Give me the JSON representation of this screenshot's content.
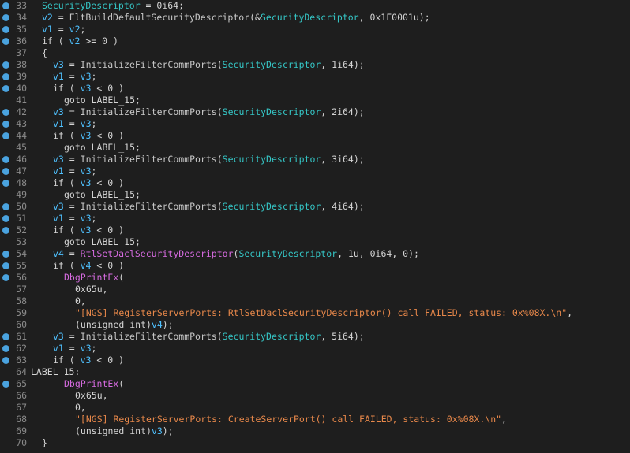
{
  "colors": {
    "background": "#1e1e1e",
    "breakpoint": "#4aa3df",
    "line_number": "#8a8a8a",
    "variable": "#4fc1ff",
    "security_descriptor": "#35c6c6",
    "api_call": "#d66be0",
    "string": "#e8884a",
    "default": "#d4d4d4"
  },
  "lines": [
    {
      "n": "33",
      "bp": true,
      "indent": 1,
      "tokens": [
        [
          "sd",
          "SecurityDescriptor"
        ],
        [
          "plain",
          " = 0i64;"
        ]
      ]
    },
    {
      "n": "34",
      "bp": true,
      "indent": 1,
      "tokens": [
        [
          "var",
          "v2"
        ],
        [
          "plain",
          " = "
        ],
        [
          "func",
          "FltBuildDefaultSecurityDescriptor"
        ],
        [
          "plain",
          "(&"
        ],
        [
          "sd",
          "SecurityDescriptor"
        ],
        [
          "plain",
          ", 0x1F0001u);"
        ]
      ]
    },
    {
      "n": "35",
      "bp": true,
      "indent": 1,
      "tokens": [
        [
          "var",
          "v1"
        ],
        [
          "plain",
          " = "
        ],
        [
          "var",
          "v2"
        ],
        [
          "plain",
          ";"
        ]
      ]
    },
    {
      "n": "36",
      "bp": true,
      "indent": 1,
      "tokens": [
        [
          "plain",
          "if ( "
        ],
        [
          "var",
          "v2"
        ],
        [
          "plain",
          " >= 0 )"
        ]
      ]
    },
    {
      "n": "37",
      "bp": false,
      "indent": 1,
      "tokens": [
        [
          "plain",
          "{"
        ]
      ]
    },
    {
      "n": "38",
      "bp": true,
      "indent": 2,
      "tokens": [
        [
          "var",
          "v3"
        ],
        [
          "plain",
          " = "
        ],
        [
          "func",
          "InitializeFilterCommPorts"
        ],
        [
          "plain",
          "("
        ],
        [
          "sd",
          "SecurityDescriptor"
        ],
        [
          "plain",
          ", 1i64);"
        ]
      ]
    },
    {
      "n": "39",
      "bp": true,
      "indent": 2,
      "tokens": [
        [
          "var",
          "v1"
        ],
        [
          "plain",
          " = "
        ],
        [
          "var",
          "v3"
        ],
        [
          "plain",
          ";"
        ]
      ]
    },
    {
      "n": "40",
      "bp": true,
      "indent": 2,
      "tokens": [
        [
          "plain",
          "if ( "
        ],
        [
          "var",
          "v3"
        ],
        [
          "plain",
          " < 0 )"
        ]
      ]
    },
    {
      "n": "41",
      "bp": false,
      "indent": 3,
      "tokens": [
        [
          "plain",
          "goto LABEL_15;"
        ]
      ]
    },
    {
      "n": "42",
      "bp": true,
      "indent": 2,
      "tokens": [
        [
          "var",
          "v3"
        ],
        [
          "plain",
          " = "
        ],
        [
          "func",
          "InitializeFilterCommPorts"
        ],
        [
          "plain",
          "("
        ],
        [
          "sd",
          "SecurityDescriptor"
        ],
        [
          "plain",
          ", 2i64);"
        ]
      ]
    },
    {
      "n": "43",
      "bp": true,
      "indent": 2,
      "tokens": [
        [
          "var",
          "v1"
        ],
        [
          "plain",
          " = "
        ],
        [
          "var",
          "v3"
        ],
        [
          "plain",
          ";"
        ]
      ]
    },
    {
      "n": "44",
      "bp": true,
      "indent": 2,
      "tokens": [
        [
          "plain",
          "if ( "
        ],
        [
          "var",
          "v3"
        ],
        [
          "plain",
          " < 0 )"
        ]
      ]
    },
    {
      "n": "45",
      "bp": false,
      "indent": 3,
      "tokens": [
        [
          "plain",
          "goto LABEL_15;"
        ]
      ]
    },
    {
      "n": "46",
      "bp": true,
      "indent": 2,
      "tokens": [
        [
          "var",
          "v3"
        ],
        [
          "plain",
          " = "
        ],
        [
          "func",
          "InitializeFilterCommPorts"
        ],
        [
          "plain",
          "("
        ],
        [
          "sd",
          "SecurityDescriptor"
        ],
        [
          "plain",
          ", 3i64);"
        ]
      ]
    },
    {
      "n": "47",
      "bp": true,
      "indent": 2,
      "tokens": [
        [
          "var",
          "v1"
        ],
        [
          "plain",
          " = "
        ],
        [
          "var",
          "v3"
        ],
        [
          "plain",
          ";"
        ]
      ]
    },
    {
      "n": "48",
      "bp": true,
      "indent": 2,
      "tokens": [
        [
          "plain",
          "if ( "
        ],
        [
          "var",
          "v3"
        ],
        [
          "plain",
          " < 0 )"
        ]
      ]
    },
    {
      "n": "49",
      "bp": false,
      "indent": 3,
      "tokens": [
        [
          "plain",
          "goto LABEL_15;"
        ]
      ]
    },
    {
      "n": "50",
      "bp": true,
      "indent": 2,
      "tokens": [
        [
          "var",
          "v3"
        ],
        [
          "plain",
          " = "
        ],
        [
          "func",
          "InitializeFilterCommPorts"
        ],
        [
          "plain",
          "("
        ],
        [
          "sd",
          "SecurityDescriptor"
        ],
        [
          "plain",
          ", 4i64);"
        ]
      ]
    },
    {
      "n": "51",
      "bp": true,
      "indent": 2,
      "tokens": [
        [
          "var",
          "v1"
        ],
        [
          "plain",
          " = "
        ],
        [
          "var",
          "v3"
        ],
        [
          "plain",
          ";"
        ]
      ]
    },
    {
      "n": "52",
      "bp": true,
      "indent": 2,
      "tokens": [
        [
          "plain",
          "if ( "
        ],
        [
          "var",
          "v3"
        ],
        [
          "plain",
          " < 0 )"
        ]
      ]
    },
    {
      "n": "53",
      "bp": false,
      "indent": 3,
      "tokens": [
        [
          "plain",
          "goto LABEL_15;"
        ]
      ]
    },
    {
      "n": "54",
      "bp": true,
      "indent": 2,
      "tokens": [
        [
          "var",
          "v4"
        ],
        [
          "plain",
          " = "
        ],
        [
          "api",
          "RtlSetDaclSecurityDescriptor"
        ],
        [
          "plain",
          "("
        ],
        [
          "sd",
          "SecurityDescriptor"
        ],
        [
          "plain",
          ", 1u, 0i64, 0);"
        ]
      ]
    },
    {
      "n": "55",
      "bp": true,
      "indent": 2,
      "tokens": [
        [
          "plain",
          "if ( "
        ],
        [
          "var",
          "v4"
        ],
        [
          "plain",
          " < 0 )"
        ]
      ]
    },
    {
      "n": "56",
      "bp": true,
      "indent": 3,
      "tokens": [
        [
          "api",
          "DbgPrintEx"
        ],
        [
          "plain",
          "("
        ]
      ]
    },
    {
      "n": "57",
      "bp": false,
      "indent": 4,
      "tokens": [
        [
          "plain",
          "0x65u,"
        ]
      ]
    },
    {
      "n": "58",
      "bp": false,
      "indent": 4,
      "tokens": [
        [
          "plain",
          "0,"
        ]
      ]
    },
    {
      "n": "59",
      "bp": false,
      "indent": 4,
      "tokens": [
        [
          "str",
          "\"[NGS] RegisterServerPorts: RtlSetDaclSecurityDescriptor() call FAILED, status: 0x%08X.\\n\""
        ],
        [
          "plain",
          ","
        ]
      ]
    },
    {
      "n": "60",
      "bp": false,
      "indent": 4,
      "tokens": [
        [
          "plain",
          "(unsigned int)"
        ],
        [
          "var",
          "v4"
        ],
        [
          "plain",
          ");"
        ]
      ]
    },
    {
      "n": "61",
      "bp": true,
      "indent": 2,
      "tokens": [
        [
          "var",
          "v3"
        ],
        [
          "plain",
          " = "
        ],
        [
          "func",
          "InitializeFilterCommPorts"
        ],
        [
          "plain",
          "("
        ],
        [
          "sd",
          "SecurityDescriptor"
        ],
        [
          "plain",
          ", 5i64);"
        ]
      ]
    },
    {
      "n": "62",
      "bp": true,
      "indent": 2,
      "tokens": [
        [
          "var",
          "v1"
        ],
        [
          "plain",
          " = "
        ],
        [
          "var",
          "v3"
        ],
        [
          "plain",
          ";"
        ]
      ]
    },
    {
      "n": "63",
      "bp": true,
      "indent": 2,
      "tokens": [
        [
          "plain",
          "if ( "
        ],
        [
          "var",
          "v3"
        ],
        [
          "plain",
          " < 0 )"
        ]
      ]
    },
    {
      "n": "64",
      "bp": false,
      "indent": 0,
      "tokens": [
        [
          "plain",
          "LABEL_15:"
        ]
      ]
    },
    {
      "n": "65",
      "bp": true,
      "indent": 3,
      "tokens": [
        [
          "api",
          "DbgPrintEx"
        ],
        [
          "plain",
          "("
        ]
      ]
    },
    {
      "n": "66",
      "bp": false,
      "indent": 4,
      "tokens": [
        [
          "plain",
          "0x65u,"
        ]
      ]
    },
    {
      "n": "67",
      "bp": false,
      "indent": 4,
      "tokens": [
        [
          "plain",
          "0,"
        ]
      ]
    },
    {
      "n": "68",
      "bp": false,
      "indent": 4,
      "tokens": [
        [
          "str",
          "\"[NGS] RegisterServerPorts: CreateServerPort() call FAILED, status: 0x%08X.\\n\""
        ],
        [
          "plain",
          ","
        ]
      ]
    },
    {
      "n": "69",
      "bp": false,
      "indent": 4,
      "tokens": [
        [
          "plain",
          "(unsigned int)"
        ],
        [
          "var",
          "v3"
        ],
        [
          "plain",
          ");"
        ]
      ]
    },
    {
      "n": "70",
      "bp": false,
      "indent": 1,
      "tokens": [
        [
          "plain",
          "}"
        ]
      ]
    }
  ]
}
